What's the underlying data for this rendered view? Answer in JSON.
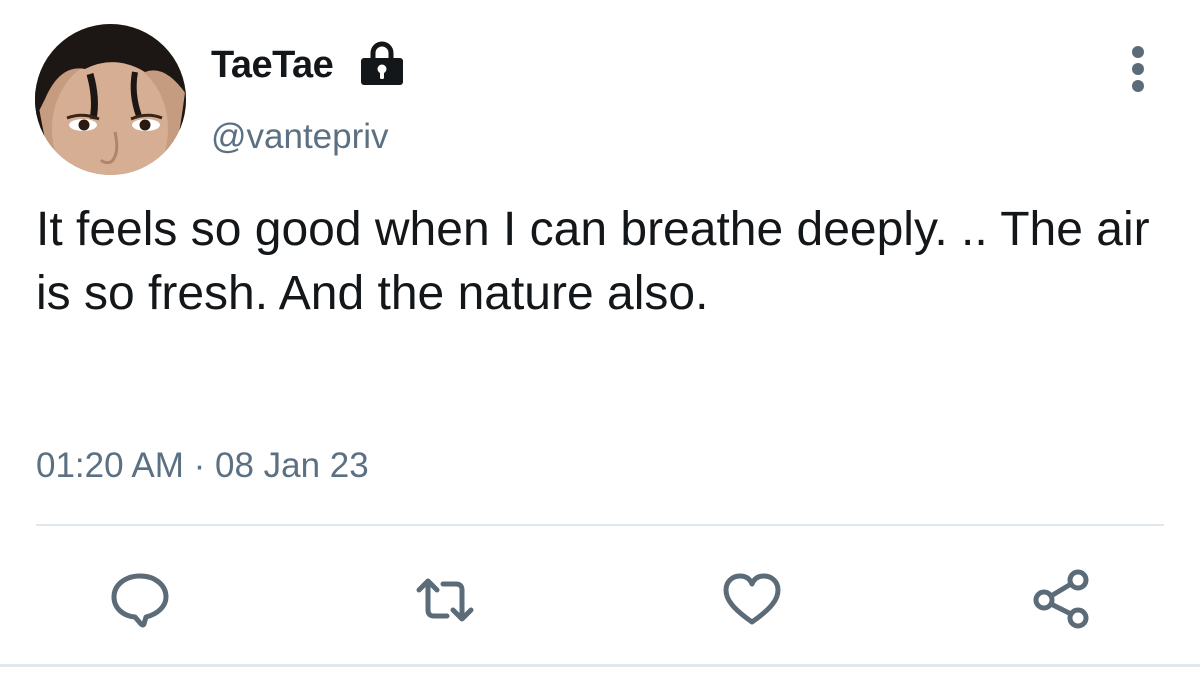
{
  "tweet": {
    "display_name": "TaeTae",
    "handle": "@vantepriv",
    "text": "It feels so good when I can breathe deeply. .. The air is so fresh. And the nature also.",
    "time": "01:20 AM",
    "separator": " · ",
    "date": "08 Jan 23",
    "protected": true
  },
  "icons": {
    "lock": "lock-icon",
    "more": "vertical-ellipsis-icon",
    "reply": "speech-bubble-icon",
    "retweet": "retweet-icon",
    "like": "heart-icon",
    "share": "share-icon"
  },
  "colors": {
    "primary_text": "#14171a",
    "secondary_text": "#5b7083",
    "icon": "#5b6b78",
    "divider": "#e1e8ed"
  }
}
